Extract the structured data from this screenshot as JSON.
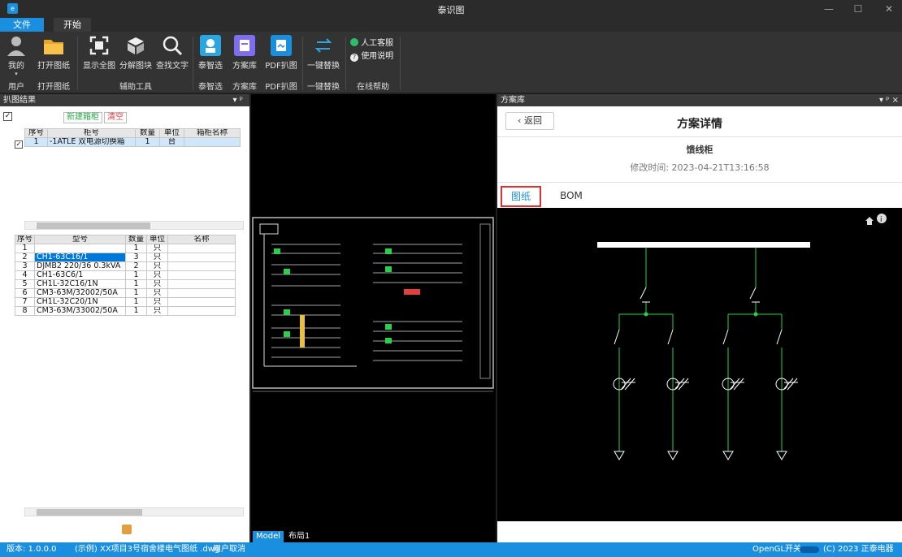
{
  "app": {
    "title": "泰识图"
  },
  "menu_tabs": [
    "文件",
    "开始"
  ],
  "ribbon": {
    "buttons": [
      {
        "label": "我的",
        "icon": "user-icon"
      },
      {
        "label": "打开图纸",
        "icon": "folder-icon"
      },
      {
        "label": "显示全图",
        "icon": "fit-view-icon"
      },
      {
        "label": "分解图块",
        "icon": "explode-block-icon"
      },
      {
        "label": "查找文字",
        "icon": "search-icon"
      },
      {
        "label": "泰智选",
        "icon": "smart-select-icon"
      },
      {
        "label": "方案库",
        "icon": "scheme-library-icon"
      },
      {
        "label": "PDF扒图",
        "icon": "pdf-extract-icon"
      },
      {
        "label": "一键替换",
        "icon": "swap-icon"
      }
    ],
    "help_items": [
      "人工客服",
      "使用说明"
    ],
    "groups": [
      "用户",
      "打开图纸",
      "辅助工具",
      "泰智选",
      "方案库",
      "PDF扒图",
      "一键替换",
      "在线帮助"
    ]
  },
  "left_panel": {
    "title": "扒图结果",
    "pin": "▾ ᵖ",
    "new_cabinet": "新建箱柜",
    "clear": "清空",
    "cabinet_columns": [
      "序号",
      "柜号",
      "数量",
      "单位",
      "箱柜名称"
    ],
    "cabinet_rows": [
      {
        "no": "1",
        "code": "-1ATLE 双电源切换箱",
        "qty": "1",
        "unit": "台",
        "name": ""
      }
    ],
    "part_columns": [
      "序号",
      "型号",
      "数量",
      "单位",
      "名称"
    ],
    "part_rows": [
      {
        "no": "1",
        "model": "",
        "qty": "1",
        "unit": "只",
        "name": ""
      },
      {
        "no": "2",
        "model": "CH1-63C16/1",
        "qty": "3",
        "unit": "只",
        "name": ""
      },
      {
        "no": "3",
        "model": "DJMB2 220/36 0.3kVA",
        "qty": "2",
        "unit": "只",
        "name": ""
      },
      {
        "no": "4",
        "model": "CH1-63C6/1",
        "qty": "1",
        "unit": "只",
        "name": ""
      },
      {
        "no": "5",
        "model": "CH1L-32C16/1N",
        "qty": "1",
        "unit": "只",
        "name": ""
      },
      {
        "no": "6",
        "model": "CM3-63M/32002/50A",
        "qty": "1",
        "unit": "只",
        "name": ""
      },
      {
        "no": "7",
        "model": "CH1L-32C20/1N",
        "qty": "1",
        "unit": "只",
        "name": ""
      },
      {
        "no": "8",
        "model": "CM3-63M/33002/50A",
        "qty": "1",
        "unit": "只",
        "name": ""
      }
    ]
  },
  "center_panel": {
    "tabs": [
      "Model",
      "布局1"
    ]
  },
  "right_panel": {
    "title": "方案库",
    "pin": "▾ ᵖ ×",
    "back": "‹ 返回",
    "header": "方案详情",
    "scheme_name": "馈线柜",
    "modified": "修改时间: 2023-04-21T13:16:58",
    "tabs": [
      "图纸",
      "BOM"
    ]
  },
  "statusbar": {
    "version": "版本: 1.0.0.0",
    "file": "(示例) XX项目3号宿舍楼电气图纸 .dwg",
    "user_action": "用户取消",
    "opengl": "OpenGL开关",
    "copyright": "(C) 2023 正泰电器"
  }
}
